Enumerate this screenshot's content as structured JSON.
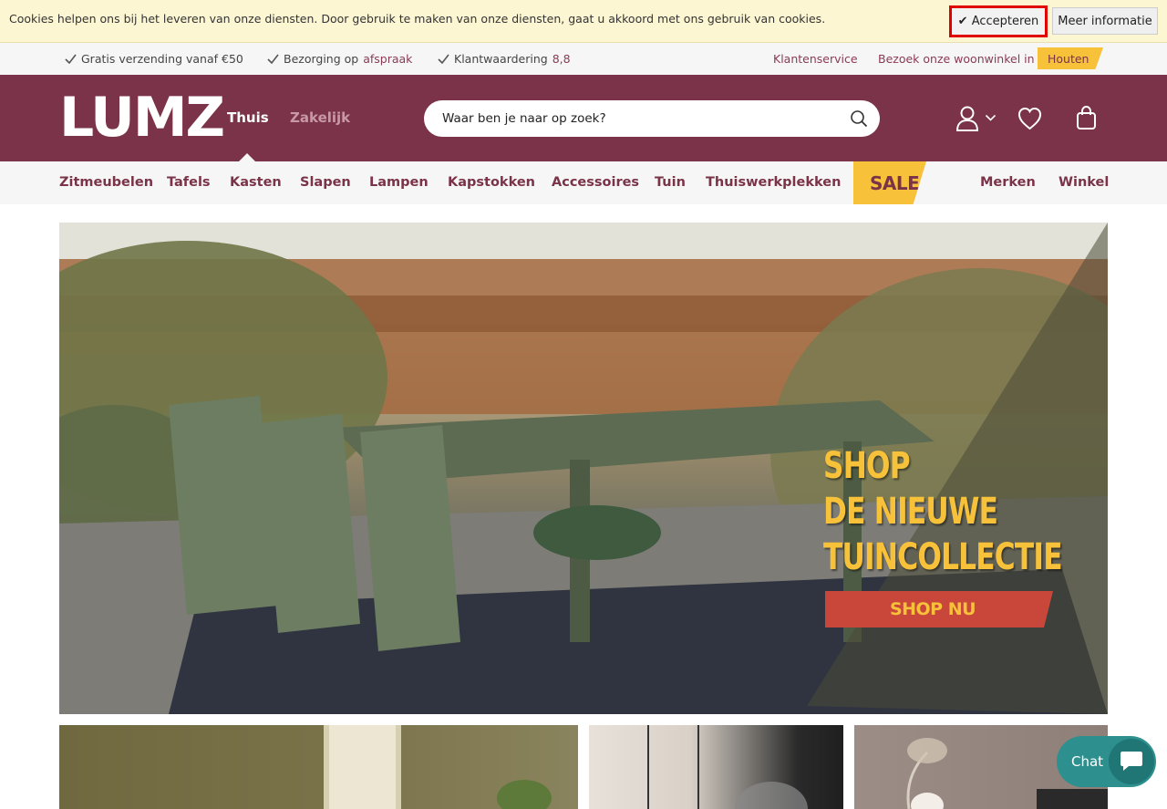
{
  "cookie_bar": {
    "text": "Cookies helpen ons bij het leveren van onze diensten. Door gebruik te maken van onze diensten, gaat u akkoord met ons gebruik van cookies.",
    "accept_label": "✔ Accepteren",
    "more_label": "Meer informatie"
  },
  "usp": {
    "free_shipping": "Gratis verzending vanaf €50",
    "delivery_prefix": "Bezorging op",
    "delivery_link": "afspraak",
    "rating_prefix": "Klantwaardering",
    "rating_value": "8,8",
    "customer_service": "Klantenservice",
    "visit_store": "Bezoek onze woonwinkel in",
    "store_city": "Houten"
  },
  "header": {
    "logo": "LUMZ",
    "tab_home": "Thuis",
    "tab_business": "Zakelijk",
    "search_placeholder": "Waar ben je naar op zoek?"
  },
  "nav": {
    "items": [
      "Zitmeubelen",
      "Tafels",
      "Kasten",
      "Slapen",
      "Lampen",
      "Kapstokken",
      "Accessoires",
      "Tuin",
      "Thuiswerkplekken"
    ],
    "sale": "SALE",
    "brands": "Merken",
    "store": "Winkel"
  },
  "hero": {
    "line1": "SHOP",
    "line2": "DE NIEUWE",
    "line3": "TUINCOLLECTIE",
    "cta": "SHOP NU"
  },
  "chat": {
    "label": "Chat"
  },
  "colors": {
    "brand": "#7a3348",
    "accent_yellow": "#f7c23a",
    "cta_red": "#c9473a",
    "chat_teal": "#2d8f8e"
  }
}
